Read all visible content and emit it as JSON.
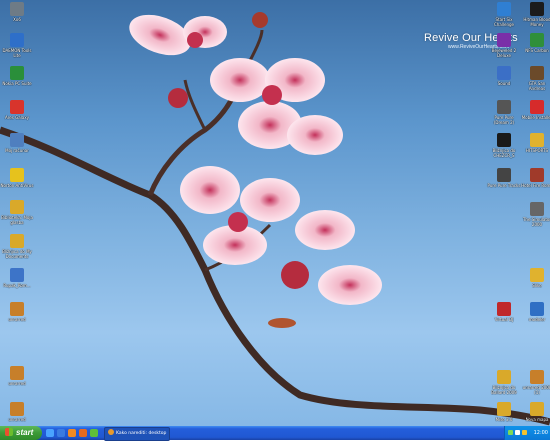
{
  "watermark": {
    "title": "Revive Our Hearts",
    "url": "www.ReviveOurHearts.com"
  },
  "left_icons": [
    {
      "id": "xo6",
      "label": "Xo6",
      "color": "#6e7b86",
      "glyph": "folder-icon"
    },
    {
      "id": "daemon",
      "label": "DAEMON Tools Lite",
      "color": "#2e6fc9",
      "glyph": "daemon-icon"
    },
    {
      "id": "nokia",
      "label": "Nokia PC Suite",
      "color": "#2a8f3a",
      "glyph": "nokia-icon"
    },
    {
      "id": "ares",
      "label": "Ares Galaxy",
      "color": "#d8342c",
      "glyph": "ares-icon"
    },
    {
      "id": "moj",
      "label": "Moj računar",
      "color": "#4f7fbf",
      "glyph": "computer-icon"
    },
    {
      "id": "norton",
      "label": "Norton AntiVirus",
      "color": "#e6c21d",
      "glyph": "norton-icon"
    },
    {
      "id": "biblioteka",
      "label": "Biblioteka: Moja glasba",
      "color": "#d9a92a",
      "glyph": "folder-icon"
    },
    {
      "id": "mydocs",
      "label": "Bližnjica do My Documents",
      "color": "#d9a92a",
      "glyph": "folder-icon"
    },
    {
      "id": "rupak",
      "label": "Rupak_Rom...",
      "color": "#3d74c8",
      "glyph": "document-icon"
    },
    {
      "id": "unrar1",
      "label": "unrarred",
      "color": "#c77f2a",
      "glyph": "archive-icon"
    },
    {
      "id": "unrar2",
      "label": "unrarred",
      "color": "#c77f2a",
      "glyph": "archive-icon"
    },
    {
      "id": "unrar3",
      "label": "unrarred",
      "color": "#c77f2a",
      "glyph": "archive-icon"
    }
  ],
  "right_icons": [
    {
      "id": "startsix",
      "label": "Start Six Challenge",
      "color": "#2f7fd3",
      "glyph": "app-icon"
    },
    {
      "id": "hitman",
      "label": "Hitman Blood Money",
      "color": "#1b1b1b",
      "glyph": "game-icon"
    },
    {
      "id": "bejeweled",
      "label": "Bejeweled 2 Deluxe",
      "color": "#7a2fa8",
      "glyph": "game-icon"
    },
    {
      "id": "nfs",
      "label": "NFS Carbon",
      "color": "#2f8f3a",
      "glyph": "game-icon"
    },
    {
      "id": "sound",
      "label": "Sound",
      "color": "#3b6fc6",
      "glyph": "sound-icon"
    },
    {
      "id": "gtasa",
      "label": "GTA San Andreas",
      "color": "#6b4a2a",
      "glyph": "game-icon"
    },
    {
      "id": "pure",
      "label": "Pure Pure (Dream 2)",
      "color": "#555555",
      "glyph": "app-icon"
    },
    {
      "id": "mlauncher",
      "label": "Mobile Installer",
      "color": "#d62b2b",
      "glyph": "m-icon"
    },
    {
      "id": "chezcr",
      "label": "Bližnjica do CHEZCR_S",
      "color": "#1a1a1a",
      "glyph": "app-icon"
    },
    {
      "id": "hitsports",
      "label": "HITSPORTS",
      "color": "#e0b22e",
      "glyph": "folder-icon"
    },
    {
      "id": "pure2",
      "label": "Pure Pure Tracks",
      "color": "#444444",
      "glyph": "app-icon"
    },
    {
      "id": "hotelfire",
      "label": "Hotel Fire Rome",
      "color": "#a03a2a",
      "glyph": "game-icon"
    },
    {
      "id": "sim",
      "label": "The Simulator 2000",
      "color": "#666666",
      "glyph": "app-icon"
    },
    {
      "id": "slike",
      "label": "Slike",
      "color": "#e0b22e",
      "glyph": "folder-icon"
    },
    {
      "id": "virtualdj",
      "label": "Virtual DJ",
      "color": "#c0282a",
      "glyph": "dj-icon"
    },
    {
      "id": "modeler",
      "label": "modeler",
      "color": "#2f6fc4",
      "glyph": "app-icon"
    },
    {
      "id": "ballandbird",
      "label": "Bližnjica do Ballard 2009",
      "color": "#d9a92a",
      "glyph": "folder-icon"
    },
    {
      "id": "unrar4",
      "label": "unrarred 2008 (1)",
      "color": "#c77f2a",
      "glyph": "archive-icon"
    },
    {
      "id": "wmc",
      "label": "Mise 3.0",
      "color": "#d9a92a",
      "glyph": "folder-icon"
    },
    {
      "id": "nova",
      "label": "Nova mapa",
      "color": "#d9a92a",
      "glyph": "folder-icon"
    }
  ],
  "taskbar": {
    "start_label": "start",
    "quick_launch": [
      {
        "name": "show-desktop-icon",
        "color": "#4aa3ff"
      },
      {
        "name": "ie-icon",
        "color": "#3b7be0"
      },
      {
        "name": "media-player-icon",
        "color": "#f08a24"
      },
      {
        "name": "firefox-icon",
        "color": "#e66a1f"
      },
      {
        "name": "msn-icon",
        "color": "#5fbf3a"
      }
    ],
    "task_label": "Kako narediti: desktop",
    "tray_icons": [
      {
        "name": "tray-network-icon",
        "color": "#7ed957"
      },
      {
        "name": "tray-volume-icon",
        "color": "#ffffff"
      },
      {
        "name": "tray-antivirus-icon",
        "color": "#f2c230"
      }
    ],
    "clock": "12:00"
  }
}
